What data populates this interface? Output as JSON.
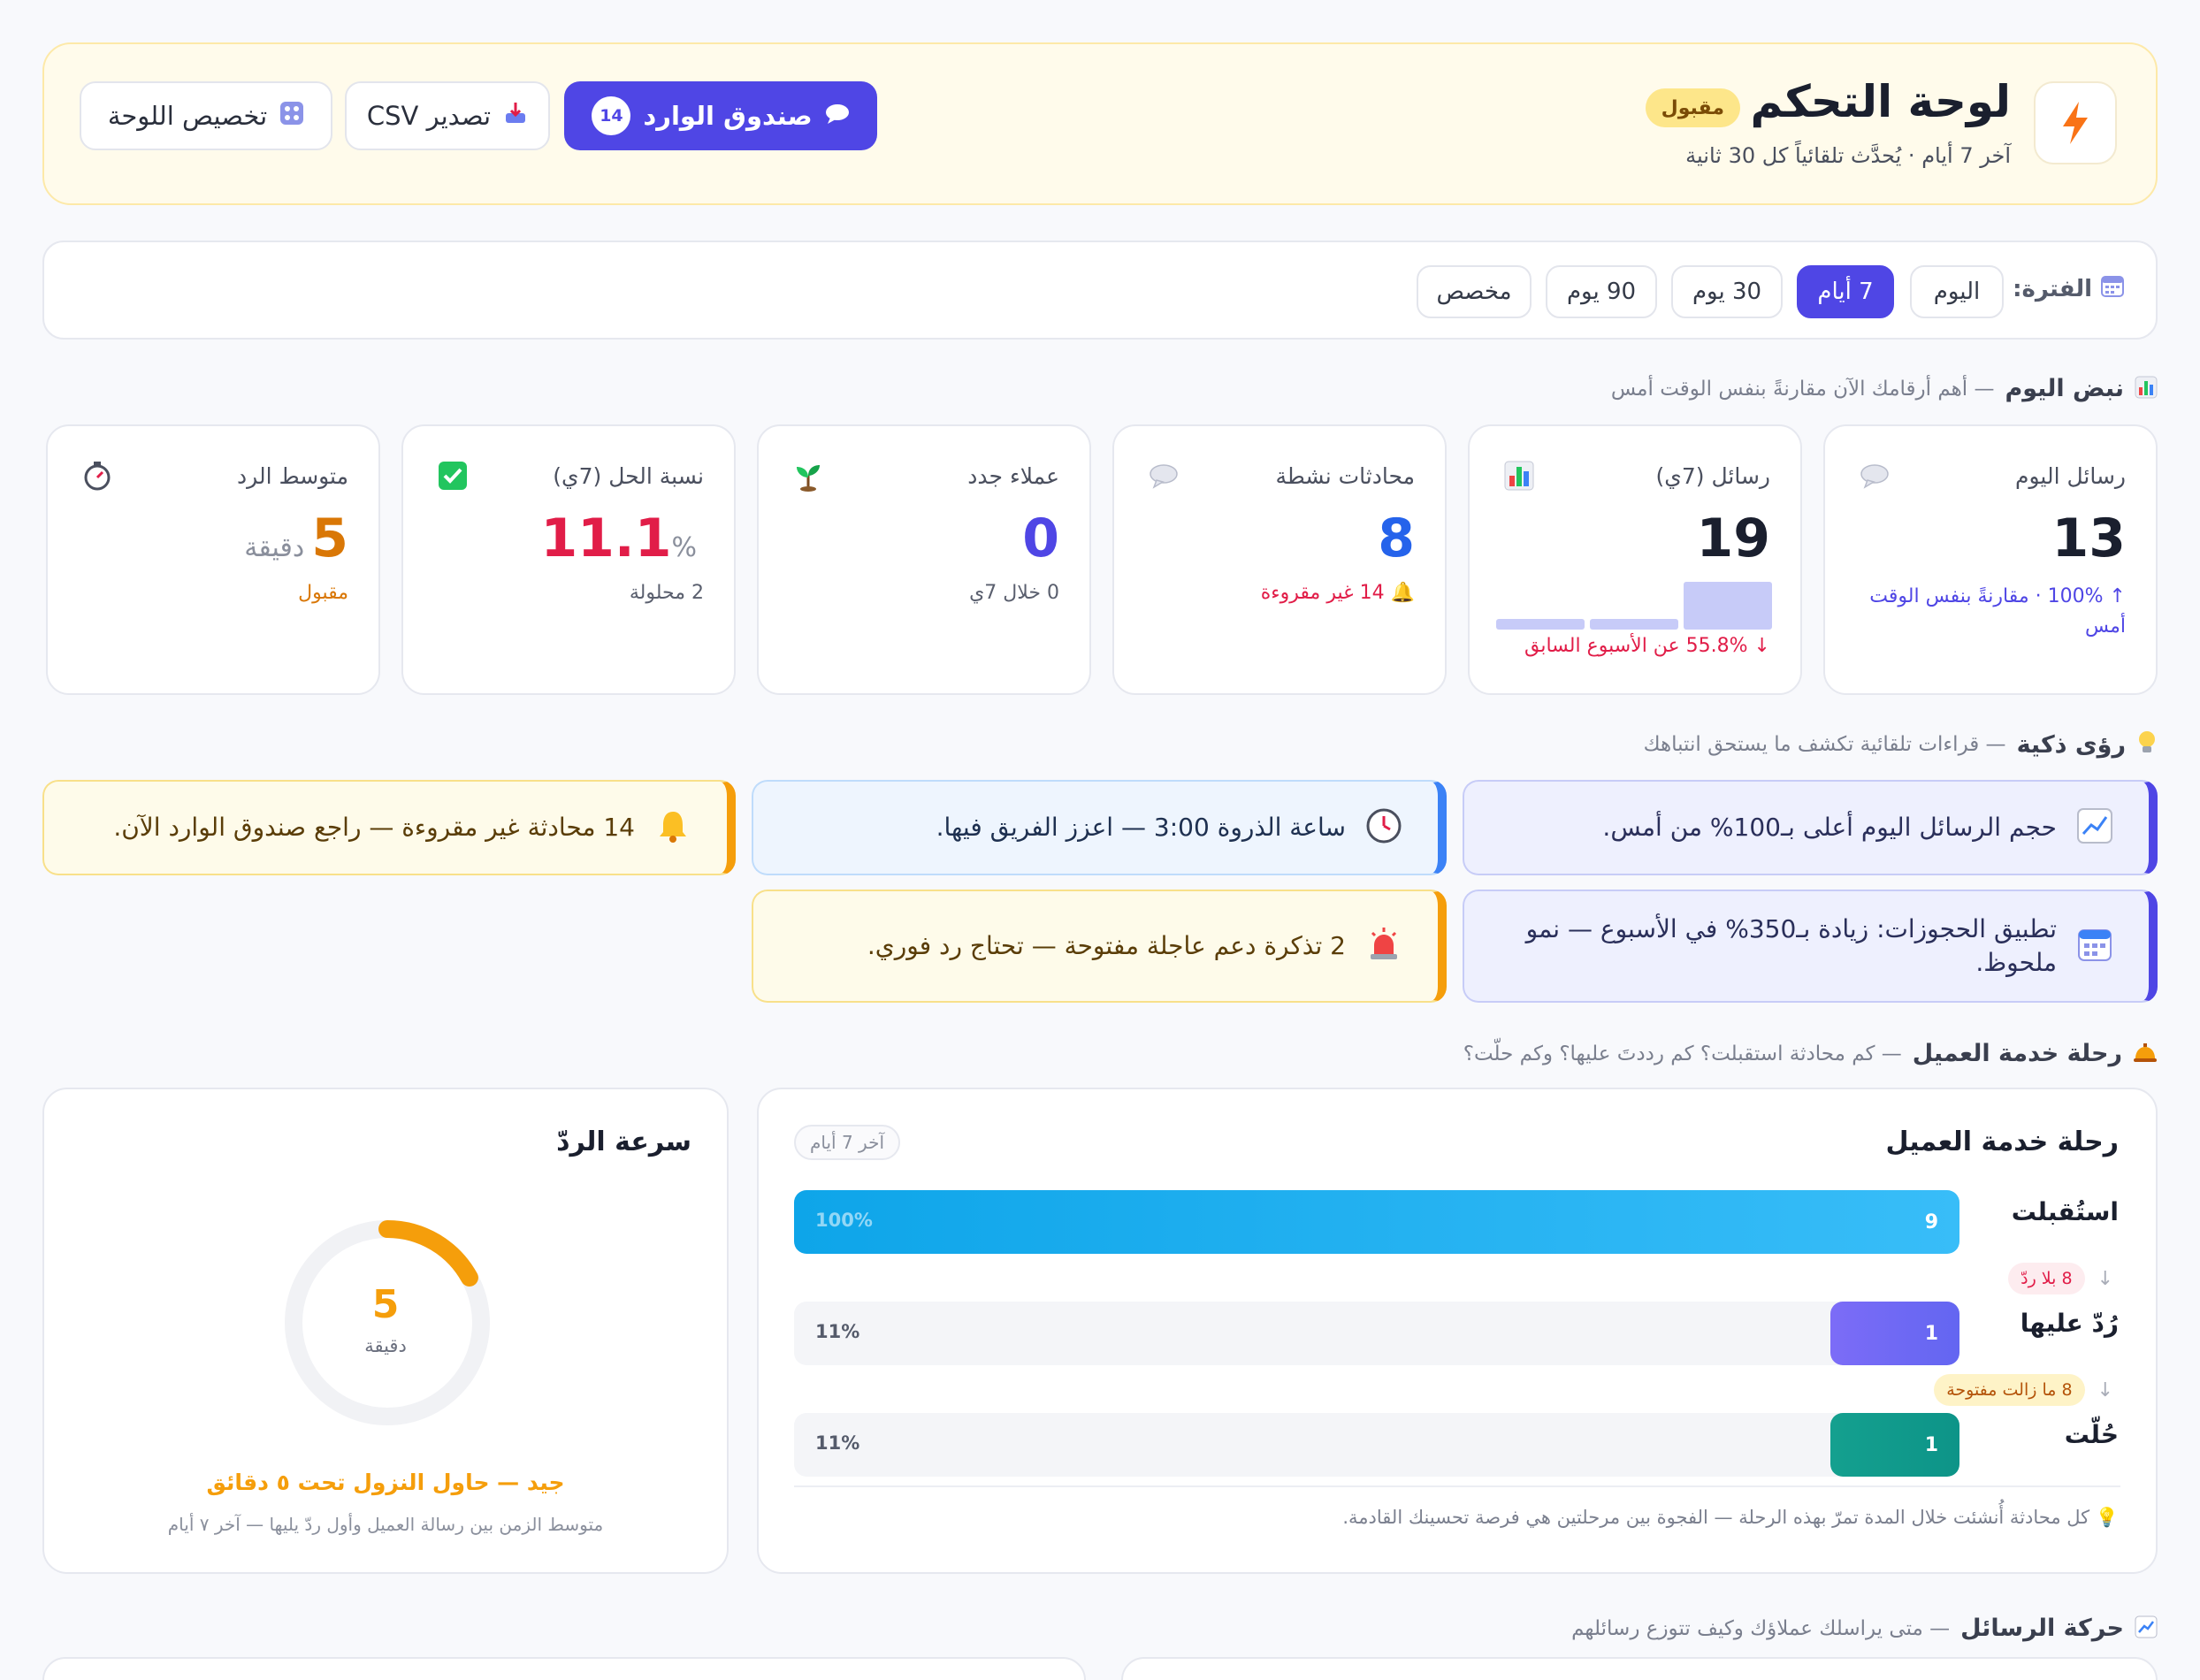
{
  "header": {
    "title": "لوحة التحكم",
    "badge": "مقبول",
    "subtitle": "آخر 7 أيام · يُحدَّث تلقائياً كل 30 ثانية",
    "logo_icon": "lightning-icon",
    "inbox_label": "صندوق الوارد",
    "inbox_count": "14",
    "export_label": "تصدير CSV",
    "customize_label": "تخصيص اللوحة"
  },
  "period": {
    "label": "الفترة:",
    "options": [
      "اليوم",
      "7 أيام",
      "30 يوم",
      "90 يوم",
      "مخصص"
    ],
    "selected": "7 أيام"
  },
  "pulse": {
    "title": "نبض اليوم",
    "desc": "— أهم أرقامك الآن مقارنةً بنفس الوقت أمس"
  },
  "kpis": [
    {
      "label": "رسائل اليوم",
      "value": "13",
      "unit": "",
      "note": "↑ 100% · مقارنةً بنفس الوقت أمس",
      "icon": "speech-bubble-icon"
    },
    {
      "label": "رسائل (7ي)",
      "value": "19",
      "unit": "",
      "note": "↓ 55.8% عن الأسبوع السابق",
      "icon": "bar-chart-icon",
      "sparkline": [
        1,
        1,
        4.5
      ]
    },
    {
      "label": "محادثات نشطة",
      "value": "8",
      "unit": "",
      "note": "🔔 14 غير مقروءة",
      "icon": "speech-bubble-icon"
    },
    {
      "label": "عملاء جدد",
      "value": "0",
      "unit": "",
      "note": "0 خلال 7ي",
      "icon": "seedling-icon"
    },
    {
      "label": "نسبة الحل (7ي)",
      "value": "11.1",
      "unit": "%",
      "note": "2 محلولة",
      "icon": "check-box-icon"
    },
    {
      "label": "متوسط الرد",
      "value": "5",
      "unit": "دقيقة",
      "note": "مقبول",
      "icon": "stopwatch-icon"
    }
  ],
  "insights_section": {
    "title": "رؤى ذكية",
    "desc": "— قراءات تلقائية تكشف ما يستحق انتباهك"
  },
  "insights": [
    {
      "text": "حجم الرسائل اليوم أعلى بـ100% من أمس.",
      "icon": "trend-up-icon"
    },
    {
      "text": "ساعة الذروة 3:00 — اعزز الفريق فيها.",
      "icon": "clock-icon"
    },
    {
      "text": "14 محادثة غير مقروءة — راجع صندوق الوارد الآن.",
      "icon": "bell-icon"
    },
    {
      "text": "تطبيق الحجوزات: زيادة بـ350% في الأسبوع — نمو ملحوظ.",
      "icon": "calendar-icon"
    },
    {
      "text": "2 تذكرة دعم عاجلة مفتوحة — تحتاج رد فوري.",
      "icon": "siren-icon"
    }
  ],
  "journey_section": {
    "title": "رحلة خدمة العميل",
    "desc": "— كم محادثة استقبلت؟ كم رددتَ عليها؟ وكم حلّت؟"
  },
  "journey": {
    "title": "رحلة خدمة العميل",
    "range": "آخر 7 أيام",
    "stages": [
      {
        "label": "استُقبلت",
        "count": "9",
        "percent": "100%",
        "fraction": 1.0
      },
      {
        "label": "رُدّ عليها",
        "count": "1",
        "percent": "11%",
        "fraction": 0.111
      },
      {
        "label": "حُلّت",
        "count": "1",
        "percent": "11%",
        "fraction": 0.111
      }
    ],
    "drops": [
      "8 بلا ردّ",
      "8 ما زالت مفتوحة"
    ],
    "note": "💡 كل محادثة أُنشئت خلال المدة تمرّ بهذه الرحلة — الفجوة بين مرحلتين هي فرصة تحسينك القادمة."
  },
  "speed": {
    "title": "سرعة الردّ",
    "value": "5",
    "unit": "دقيقة",
    "gauge_fraction": 0.17,
    "status": "جيد — حاول النزول تحت ٥ دقائق",
    "desc": "متوسط الزمن بين رسالة العميل وأول ردّ يليها — آخر ٧ أيام"
  },
  "traffic_section": {
    "title": "حركة الرسائل",
    "desc": "— متى يراسلك عملاؤك وكيف تتوزع رسائلهم"
  },
  "colors": {
    "accent": "#4f46e5",
    "header_bg": "#fffbeb",
    "kpi_today": "#1a1f2e",
    "kpi_active": "#2563eb",
    "kpi_new": "#4f46e5",
    "kpi_resolution": "#e11d48",
    "kpi_response": "#d97706",
    "stage_received": "#0ea5e9",
    "stage_replied": "#6366f1",
    "stage_resolved": "#0d9488"
  }
}
